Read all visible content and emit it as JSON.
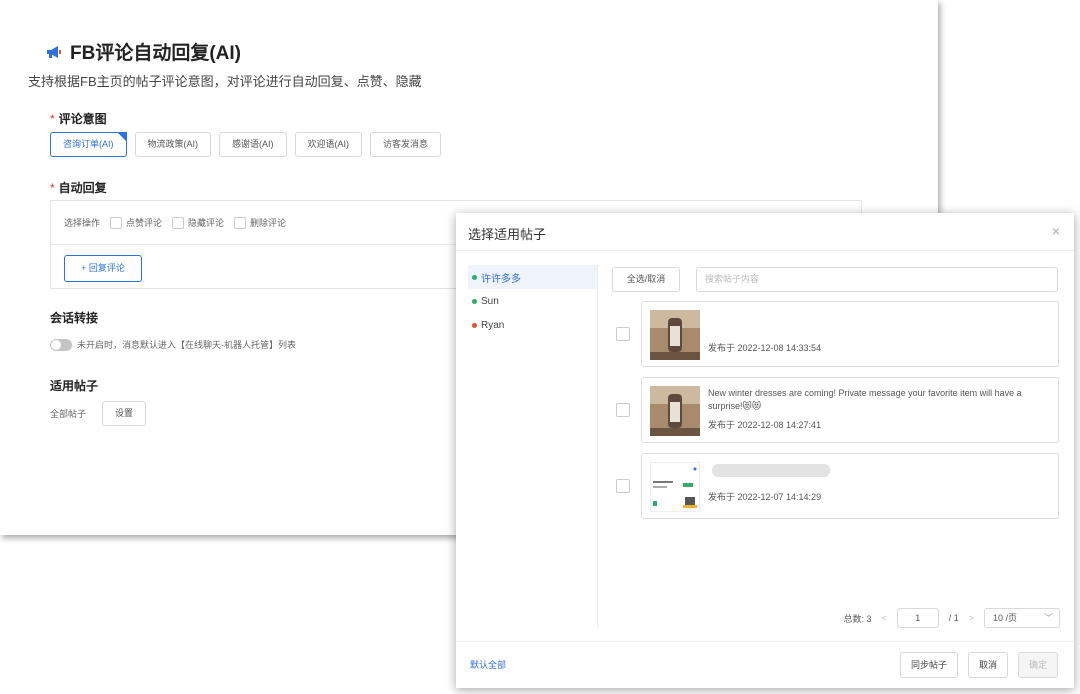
{
  "settings": {
    "title": "FB评论自动回复(AI)",
    "description": "支持根据FB主页的帖子评论意图，对评论进行自动回复、点赞、隐藏",
    "intent_label": "评论意图",
    "intents": [
      "咨询订单(AI)",
      "物流政策(AI)",
      "感谢语(AI)",
      "欢迎语(AI)",
      "访客发消息"
    ],
    "auto_reply_label": "自动回复",
    "select_action_label": "选择操作",
    "actions": [
      "点赞评论",
      "隐藏评论",
      "删除评论"
    ],
    "add_reply_label": "+ 回复评论",
    "handover_label": "会话转接",
    "handover_text": "未开启时，消息默认进入【在线聊天-机器人托管】列表",
    "posts_label": "适用帖子",
    "all_posts_label": "全部帖子",
    "set_button_label": "设置"
  },
  "modal": {
    "title": "选择适用帖子",
    "close_glyph": "×",
    "accounts": [
      {
        "name": "许许多多",
        "color": "#2faa6a"
      },
      {
        "name": "Sun",
        "color": "#2faa6a"
      },
      {
        "name": "Ryan",
        "color": "#e5502f"
      }
    ],
    "select_all_label": "全选/取消",
    "search_placeholder": "搜索帖子内容",
    "posts": [
      {
        "text": "",
        "date": "发布于 2022-12-08 14:33:54"
      },
      {
        "text": "New winter dresses are coming! Private message your favorite item will have a surprise!😻😻",
        "date": "发布于 2022-12-08 14:27:41"
      },
      {
        "text": "",
        "date": "发布于 2022-12-07 14:14:29"
      }
    ],
    "pager": {
      "total_label": "总数: 3",
      "prev": "<",
      "current_page": "1",
      "page_sep": "/ 1",
      "next": ">",
      "page_size": "10 /页",
      "chevron": "﹀"
    },
    "footer": {
      "default_all": "默认全部",
      "sync_label": "同步帖子",
      "cancel_label": "取消",
      "confirm_label": "确定"
    }
  }
}
